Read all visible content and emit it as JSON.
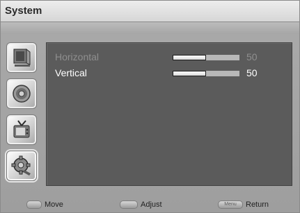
{
  "header": {
    "title": "System"
  },
  "sidebar": {
    "items": [
      {
        "icon": "monitor-icon",
        "active": false
      },
      {
        "icon": "speaker-icon",
        "active": false
      },
      {
        "icon": "tv-icon",
        "active": false
      },
      {
        "icon": "gear-icon",
        "active": true
      }
    ]
  },
  "settings": [
    {
      "label": "Horizontal",
      "value": "50",
      "level": 0.5,
      "selected": false
    },
    {
      "label": "Vertical",
      "value": "50",
      "level": 0.5,
      "selected": true
    }
  ],
  "footer": {
    "move_label": "Move",
    "adjust_label": "Adjust",
    "menu_key": "Menu",
    "return_label": "Return"
  }
}
